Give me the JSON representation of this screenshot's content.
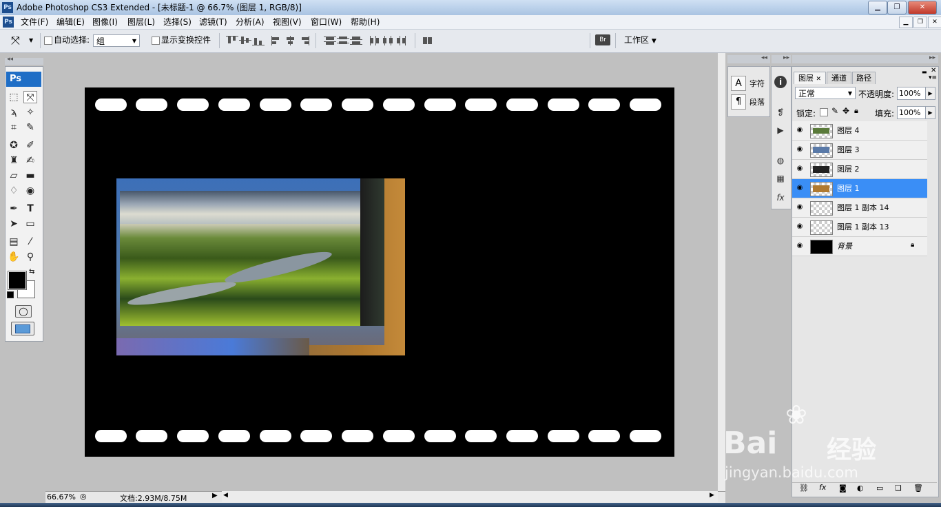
{
  "window": {
    "title": "Adobe Photoshop CS3 Extended - [未标题-1 @ 66.7% (图层 1, RGB/8)]",
    "app_icon": "Ps"
  },
  "menu": [
    "文件(F)",
    "编辑(E)",
    "图像(I)",
    "图层(L)",
    "选择(S)",
    "滤镜(T)",
    "分析(A)",
    "视图(V)",
    "窗口(W)",
    "帮助(H)"
  ],
  "options": {
    "auto_select_label": "自动选择:",
    "auto_select_value": "组",
    "show_transform_label": "显示变换控件",
    "workspace_label": "工作区"
  },
  "toolbox": {
    "logo": "Ps"
  },
  "status": {
    "zoom": "66.67%",
    "doc": "文档:2.93M/8.75M"
  },
  "char_panel": {
    "char_label": "字符",
    "para_label": "段落"
  },
  "layers_panel": {
    "tabs": [
      "图层",
      "通道",
      "路径"
    ],
    "blend_mode": "正常",
    "opacity_label": "不透明度:",
    "opacity": "100%",
    "lock_label": "锁定:",
    "fill_label": "填充:",
    "fill": "100%",
    "layers": [
      {
        "name": "图层 4",
        "selected": false
      },
      {
        "name": "图层 3",
        "selected": false
      },
      {
        "name": "图层 2",
        "selected": false
      },
      {
        "name": "图层 1",
        "selected": true
      },
      {
        "name": "图层 1 副本 14",
        "selected": false
      },
      {
        "name": "图层 1 副本 13",
        "selected": false
      },
      {
        "name": "背景",
        "selected": false
      }
    ]
  },
  "watermark": {
    "brand": "Bai",
    "brand2": "经验",
    "url": "jingyan.baidu.com"
  }
}
